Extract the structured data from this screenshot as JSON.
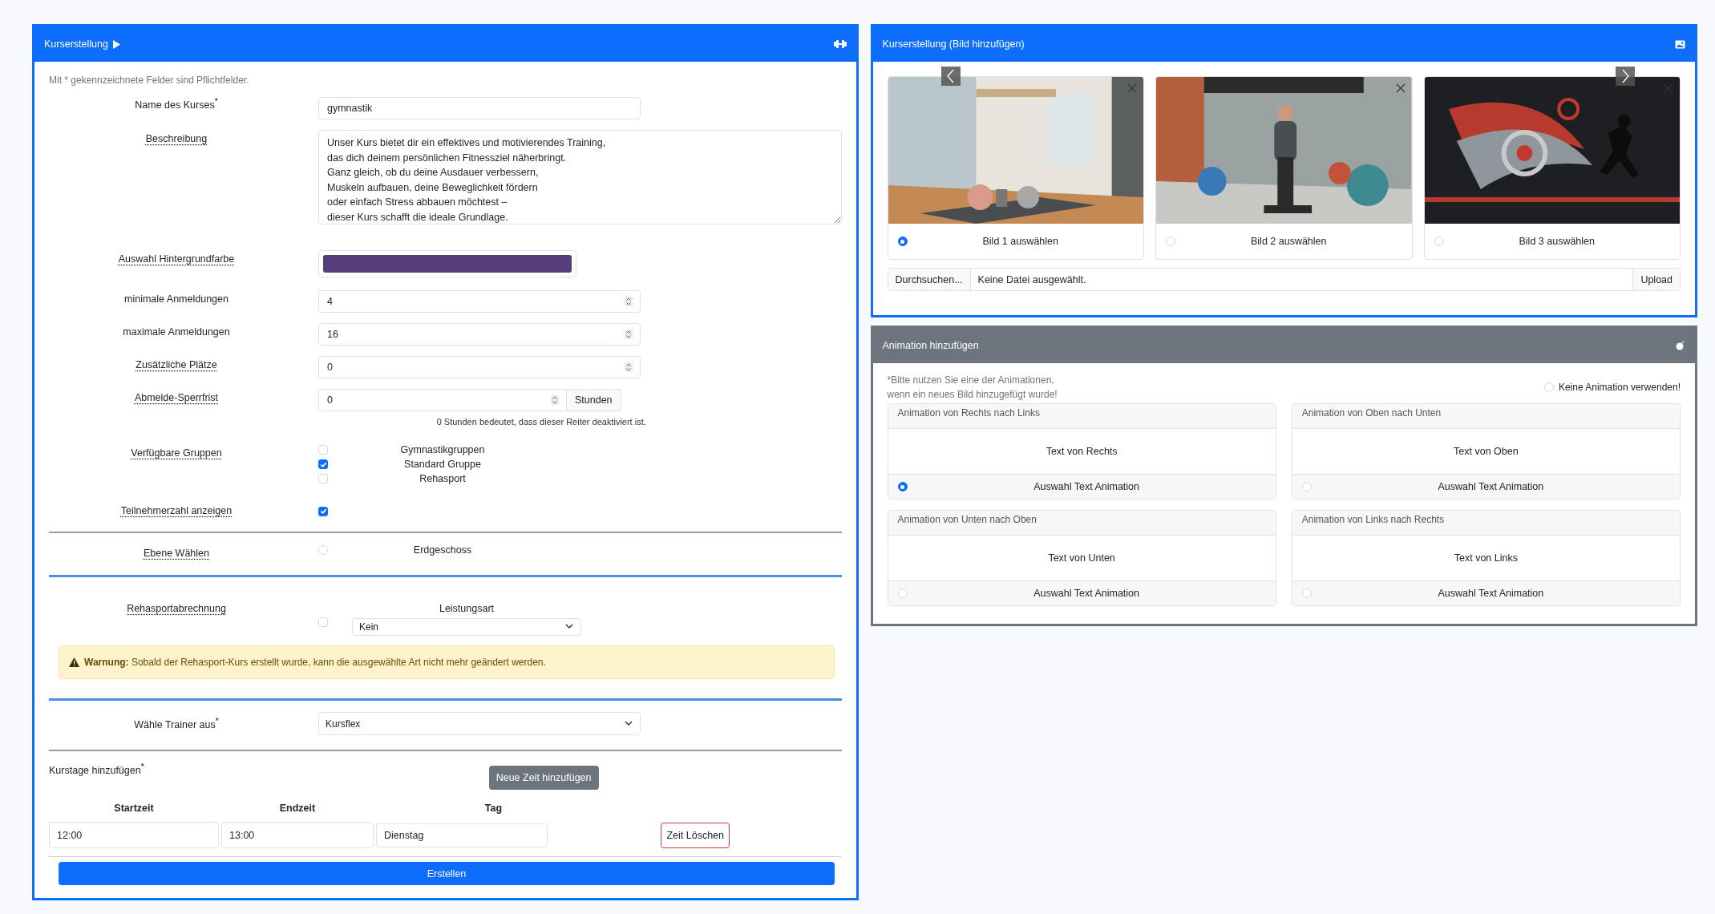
{
  "course_panel": {
    "title": "Kurserstellung",
    "required_note": "Mit * gekennzeichnete Felder sind Pflichtfelder.",
    "name": {
      "label": "Name des Kurses$^{*}$",
      "value": "gymnastik"
    },
    "description": {
      "label": "Beschreibung",
      "value": "Unser Kurs bietet dir ein effektives und motivierendes Training,\ndas dich deinem persönlichen Fitnessziel näherbringt.\nGanz gleich, ob du deine Ausdauer verbessern,\nMuskeln aufbauen, deine Beweglichkeit fördern\noder einfach Stress abbauen möchtest –\ndieser Kurs schafft die ideale Grundlage."
    },
    "background": {
      "label": "Auswahl Hintergrundfarbe",
      "color": "#563d7c"
    },
    "number_fields": [
      {
        "label": "minimale Anmeldungen",
        "value": "4",
        "underlined": false
      },
      {
        "label": "maximale Anmeldungen",
        "value": "16",
        "underlined": false
      },
      {
        "label": "Zusätzliche Plätze",
        "value": "0",
        "underlined": true
      }
    ],
    "cancel_period": {
      "label": "Abmelde-Sperrfrist",
      "value": "0",
      "unit": "Stunden",
      "hint": "0 Stunden bedeutet, dass dieser Reiter deaktiviert ist."
    },
    "groups": {
      "label": "Verfügbare Gruppen",
      "items": [
        {
          "label": "Gymnastikgruppen",
          "checked": false
        },
        {
          "label": "Standard Gruppe",
          "checked": true
        },
        {
          "label": "Rehasport",
          "checked": false
        }
      ]
    },
    "show_count": {
      "label": "Teilnehmerzahl anzeigen",
      "checked": true
    },
    "level": {
      "label": "Ebene Wählen",
      "options": [
        {
          "label": "Erdgeschoss",
          "selected": false
        }
      ]
    },
    "rehasport": {
      "label": "Rehasportabrechnung",
      "checked": false,
      "service_label": "Leistungsart",
      "service_value": "Kein",
      "warning": "**Warnung:** Sobald der Rehasport-Kurs erstellt wurde, kann die ausgewählte Art nicht mehr geändert werden."
    },
    "trainer": {
      "label": "Wähle Trainer aus$^{*}$",
      "value": "Kursflex"
    },
    "course_days": {
      "label": "Kurstage hinzufügen$^{*}$",
      "add_button": "Neue Zeit hinzufügen",
      "columns": [
        "Startzeit",
        "Endzeit",
        "Tag"
      ],
      "rows": [
        {
          "start": "12:00",
          "end": "13:00",
          "day": "Dienstag",
          "delete": "Zeit Löschen"
        }
      ]
    },
    "submit": "Erstellen"
  },
  "image_panel": {
    "title": "Kurserstellung (Bild hinzufügen)",
    "images": [
      {
        "label": "Bild 1 auswählen",
        "selected": true
      },
      {
        "label": "Bild 2 auswählen",
        "selected": false
      },
      {
        "label": "Bild 3 auswählen",
        "selected": false
      }
    ],
    "file": {
      "button": "Durchsuchen...",
      "value": "Keine Datei ausgewählt.",
      "upload": "Upload"
    }
  },
  "animation_panel": {
    "title": "Animation hinzufügen",
    "note": "*Bitte nutzen Sie eine der Animationen,\nwenn ein neues Bild hinzugefügt wurde!",
    "none_option": {
      "label": "Keine Animation verwenden!",
      "selected": false
    },
    "cards": [
      {
        "header": "Animation von Rechts nach Links",
        "sample": "Text von Rechts",
        "option": "Auswahl Text Animation",
        "selected": true
      },
      {
        "header": "Animation von Oben nach Unten",
        "sample": "Text von Oben",
        "option": "Auswahl Text Animation",
        "selected": false
      },
      {
        "header": "Animation von Unten nach Oben",
        "sample": "Text von Unten",
        "option": "Auswahl Text Animation",
        "selected": false
      },
      {
        "header": "Animation von Links nach Rechts",
        "sample": "Text von Links",
        "option": "Auswahl Text Animation",
        "selected": false
      }
    ]
  }
}
